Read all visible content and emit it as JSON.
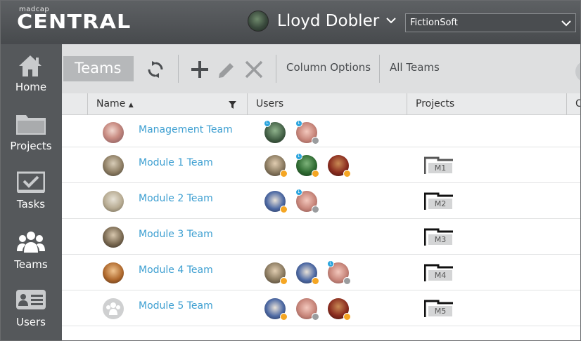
{
  "app": {
    "logo_small": "madcap",
    "logo_big": "CENTRAL",
    "user_name": "Lloyd Dobler",
    "org_selected": "FictionSoft"
  },
  "sidebar": {
    "items": [
      {
        "label": "Home",
        "icon": "home-icon"
      },
      {
        "label": "Projects",
        "icon": "folder-icon"
      },
      {
        "label": "Tasks",
        "icon": "tasks-icon"
      },
      {
        "label": "Teams",
        "icon": "teams-icon"
      },
      {
        "label": "Users",
        "icon": "users-icon"
      }
    ]
  },
  "toolbar": {
    "active_tab": "Teams",
    "column_options": "Column Options",
    "filter": "All Teams",
    "icons": [
      "refresh-icon",
      "add-icon",
      "edit-icon",
      "delete-icon"
    ]
  },
  "table": {
    "columns": [
      "Name",
      "Users",
      "Projects",
      "C"
    ],
    "sort_indicator": "▲",
    "rows": [
      {
        "name": "Management Team",
        "users": 2,
        "project": ""
      },
      {
        "name": "Module 1 Team",
        "users": 3,
        "project": "M1"
      },
      {
        "name": "Module 2 Team",
        "users": 2,
        "project": "M2"
      },
      {
        "name": "Module 3 Team",
        "users": 0,
        "project": "M3"
      },
      {
        "name": "Module 4 Team",
        "users": 3,
        "project": "M4"
      },
      {
        "name": "Module 5 Team",
        "users": 3,
        "project": "M5"
      }
    ]
  },
  "colors": {
    "header_bg": "#505356",
    "sidebar_bg": "#55585b",
    "toolbar_bg": "#dedfe0",
    "link": "#3d9fd1",
    "status_orange": "#f5a623",
    "status_grey": "#9a9c9e"
  }
}
